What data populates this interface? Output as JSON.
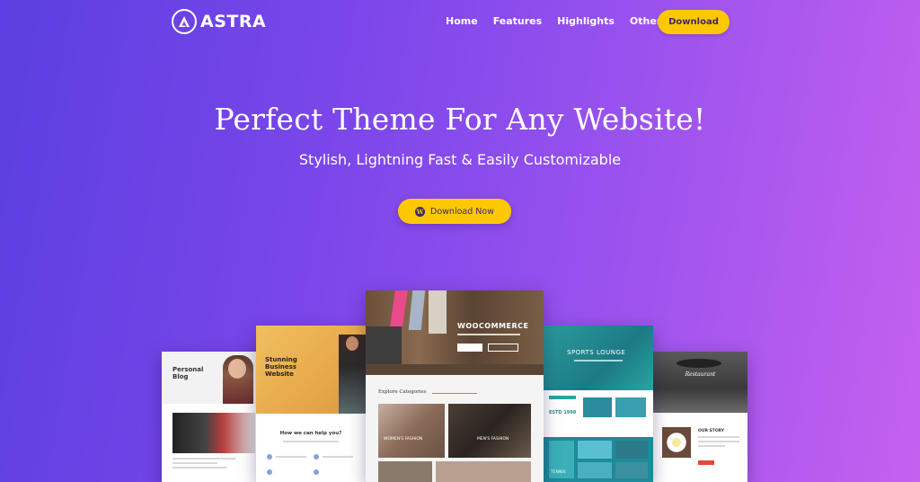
{
  "brand": {
    "name": "ASTRA"
  },
  "nav": {
    "items": [
      "Home",
      "Features",
      "Highlights",
      "Other Features"
    ],
    "download_label": "Download"
  },
  "hero": {
    "title": "Perfect Theme For Any Website!",
    "subtitle": "Stylish, Lightning Fast & Easily Customizable",
    "cta_label": "Download Now"
  },
  "mockups": {
    "blog": {
      "title": "Personal Blog"
    },
    "business": {
      "title": "Stunning Business Website",
      "section": "How we can help you?"
    },
    "woo": {
      "title": "WOOCOMMERCE",
      "section": "Explore Categories",
      "cat1": "WOMEN'S FASHION",
      "cat2": "MEN'S FASHION"
    },
    "sports": {
      "title": "SPORTS LOUNGE",
      "year": "ESTD 1998",
      "tile": "TENNIS"
    },
    "restaurant": {
      "title": "Restaurant",
      "section": "OUR STORY"
    }
  },
  "colors": {
    "gradient_start": "#5b3fe0",
    "gradient_end": "#c561ef",
    "accent": "#fdc800",
    "button_text": "#3b2a6b"
  }
}
